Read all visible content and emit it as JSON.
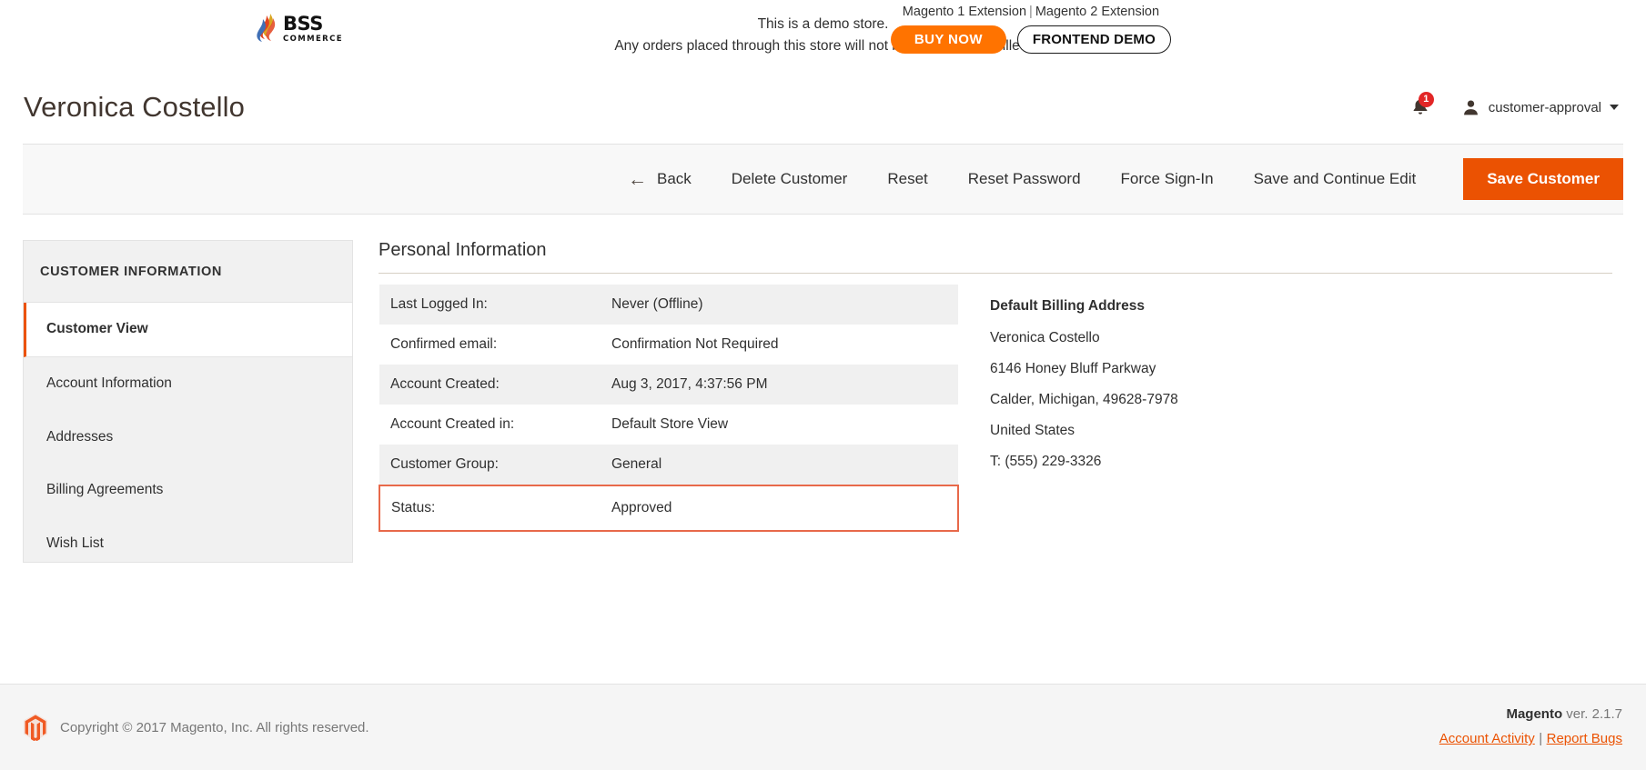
{
  "promo": {
    "logo_main": "BSS",
    "logo_sub": "COMMERCE",
    "demo_line1": "This is a demo store.",
    "demo_line2": "Any orders placed through this store will not be honored or fulfilled.",
    "ext_link_1": "Magento 1 Extension",
    "ext_sep": "|",
    "ext_link_2": "Magento 2 Extension",
    "buy_now": "BUY NOW",
    "frontend_demo": "FRONTEND DEMO",
    "accent_orange": "#ff7300"
  },
  "header": {
    "title": "Veronica Costello",
    "notification_count": "1",
    "user_name": "customer-approval"
  },
  "toolbar": {
    "back": "Back",
    "back_icon": "←",
    "delete_customer": "Delete Customer",
    "reset": "Reset",
    "reset_password": "Reset Password",
    "force_sign_in": "Force Sign-In",
    "save_and_continue": "Save and Continue Edit",
    "save_customer": "Save Customer",
    "primary_color": "#eb5202"
  },
  "sidebar": {
    "title": "CUSTOMER INFORMATION",
    "items": [
      {
        "label": "Customer View",
        "active": true
      },
      {
        "label": "Account Information",
        "active": false
      },
      {
        "label": "Addresses",
        "active": false
      },
      {
        "label": "Billing Agreements",
        "active": false
      },
      {
        "label": "Wish List",
        "active": false
      }
    ]
  },
  "main": {
    "section_title": "Personal Information",
    "rows": [
      {
        "label": "Last Logged In:",
        "value": "Never (Offline)"
      },
      {
        "label": "Confirmed email:",
        "value": "Confirmation Not Required"
      },
      {
        "label": "Account Created:",
        "value": "Aug 3, 2017, 4:37:56 PM"
      },
      {
        "label": "Account Created in:",
        "value": "Default Store View"
      },
      {
        "label": "Customer Group:",
        "value": "General"
      },
      {
        "label": "Status:",
        "value": "Approved"
      }
    ],
    "highlight_color": "#e8694a",
    "billing": {
      "title": "Default Billing Address",
      "lines": [
        "Veronica Costello",
        "6146 Honey Bluff Parkway",
        "Calder, Michigan, 49628-7978",
        "United States",
        "T: (555) 229-3326"
      ]
    }
  },
  "footer": {
    "copyright": "Copyright © 2017 Magento, Inc. All rights reserved.",
    "version_brand": "Magento",
    "version_text": " ver. 2.1.7",
    "account_activity": "Account Activity",
    "link_sep": "|",
    "report_bugs": "Report Bugs"
  }
}
